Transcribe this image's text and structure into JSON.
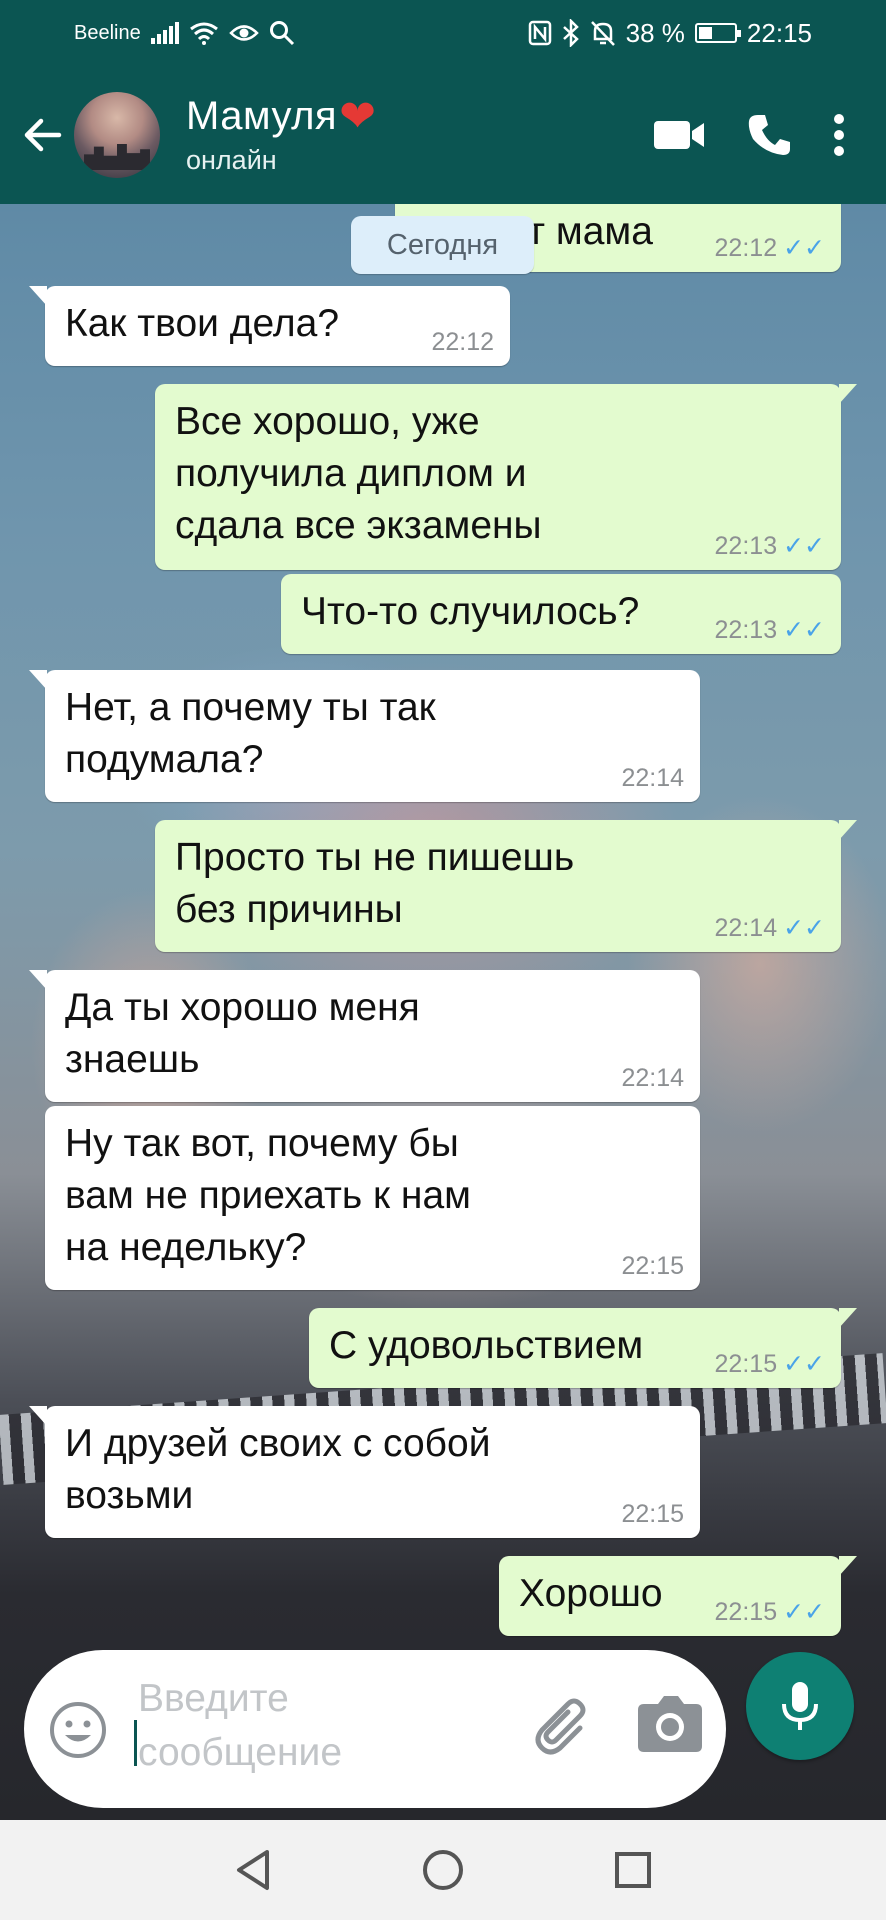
{
  "status_bar": {
    "carrier": "Beeline",
    "battery_percent": "38 %",
    "battery_level": 0.38,
    "time": "22:15",
    "icons": [
      "signal-icon",
      "wifi-icon",
      "eye-icon",
      "search-icon",
      "nfc-icon",
      "bluetooth-icon",
      "mute-icon",
      "battery-icon"
    ]
  },
  "header": {
    "contact_name": "Мамуля",
    "status": "онлайн",
    "icons": [
      "back-arrow-icon",
      "video-call-icon",
      "phone-icon",
      "more-vertical-icon"
    ]
  },
  "date_divider": "Сегодня",
  "messages": [
    {
      "dir": "out",
      "text": "Привет мама",
      "time": "22:12",
      "read": true
    },
    {
      "dir": "in",
      "text": "Как твои дела?",
      "time": "22:12"
    },
    {
      "dir": "out",
      "text": "Все хорошо, уже\nполучила диплом и\nсдала все экзамены",
      "time": "22:13",
      "read": true
    },
    {
      "dir": "out",
      "text": "Что-то случилось?",
      "time": "22:13",
      "read": true
    },
    {
      "dir": "in",
      "text": "Нет, а почему ты так\nподумала?",
      "time": "22:14"
    },
    {
      "dir": "out",
      "text": "Просто ты не пишешь\nбез причины",
      "time": "22:14",
      "read": true
    },
    {
      "dir": "in",
      "text": "Да ты хорошо меня\nзнаешь",
      "time": "22:14"
    },
    {
      "dir": "in",
      "text": "Ну так вот, почему бы\nвам не приехать к нам\nна недельку?",
      "time": "22:15"
    },
    {
      "dir": "out",
      "text": "С удовольствием",
      "time": "22:15",
      "read": true
    },
    {
      "dir": "in",
      "text": "И друзей своих с собой\nвозьми",
      "time": "22:15"
    },
    {
      "dir": "out",
      "text": "Хорошо",
      "time": "22:15",
      "read": true
    }
  ],
  "composer": {
    "placeholder": "Введите сообщение",
    "icons": [
      "emoji-icon",
      "attach-icon",
      "camera-icon",
      "mic-icon"
    ]
  },
  "nav": {
    "icons": [
      "nav-back-icon",
      "nav-home-icon",
      "nav-recents-icon"
    ]
  },
  "colors": {
    "header": "#0b5552",
    "outgoing_bubble": "#e3fbcf",
    "incoming_bubble": "#ffffff",
    "read_ticks": "#4aa3e8",
    "heart": "#e53935",
    "mic_button": "#0e8073"
  }
}
